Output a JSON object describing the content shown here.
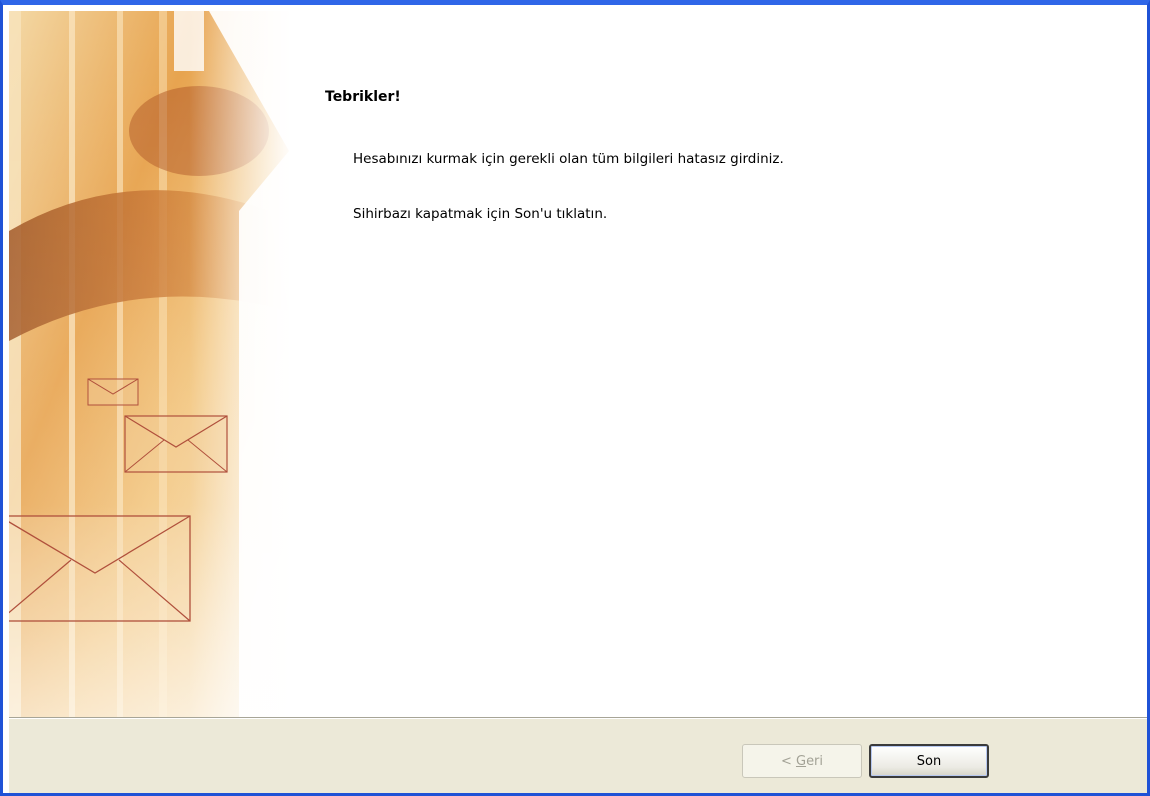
{
  "wizard": {
    "heading": "Tebrikler!",
    "message_line1": "Hesabınızı kurmak için gerekli olan tüm bilgileri hatasız girdiniz.",
    "message_line2": "Sihirbazı kapatmak için Son'u tıklatın."
  },
  "buttons": {
    "back": {
      "prefix": "< ",
      "mnemonic": "G",
      "rest": "eri",
      "enabled": false
    },
    "finish": {
      "label": "Son",
      "enabled": true
    }
  },
  "sidebar": {
    "icons": [
      "envelope-icon-small",
      "envelope-icon-medium",
      "envelope-icon-large"
    ]
  },
  "colors": {
    "window_border": "#1f52d6",
    "button_bar": "#ece9d8",
    "art_orange": "#e8963a",
    "art_brown": "#b2612a",
    "envelope_stroke": "#b0503c"
  }
}
